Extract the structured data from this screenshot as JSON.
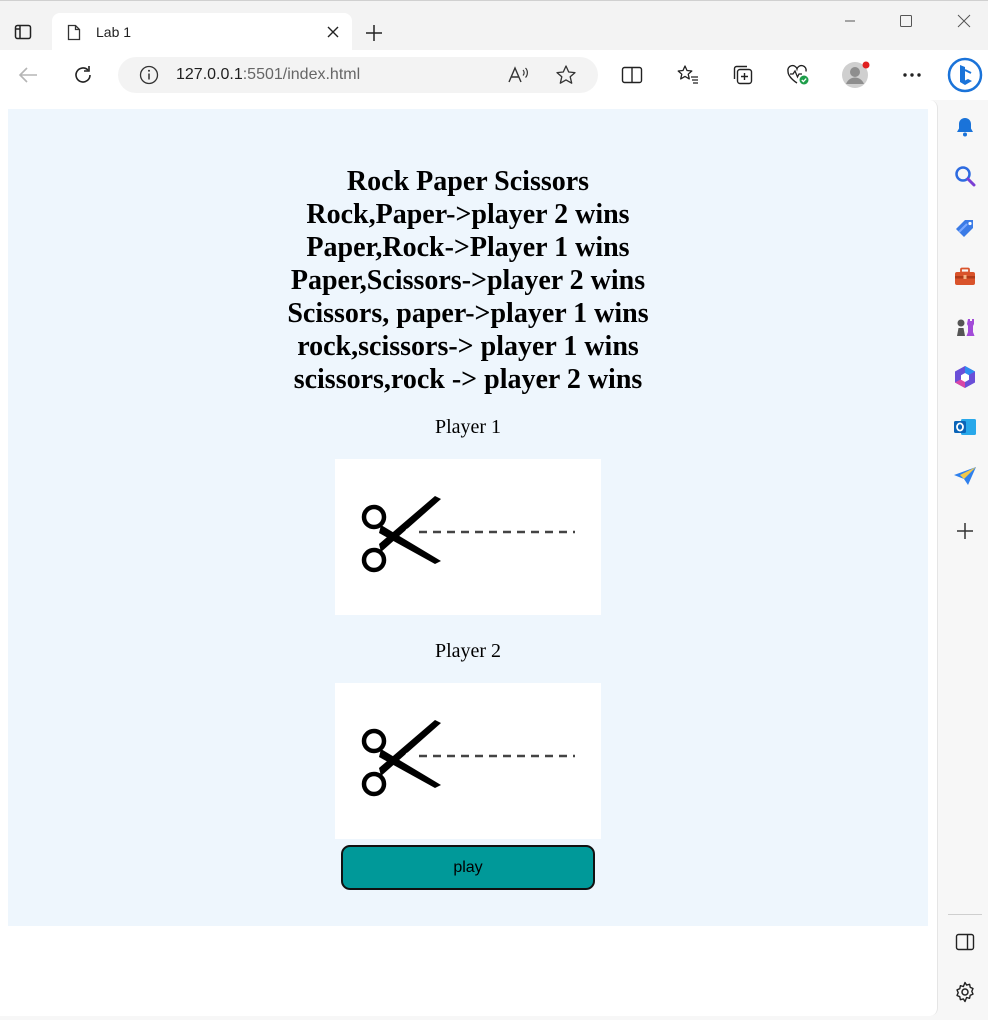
{
  "browser": {
    "tab_title": "Lab 1",
    "url_host": "127.0.0.1",
    "url_rest": ":5501/index.html"
  },
  "page": {
    "heading_lines": [
      "Rock Paper Scissors",
      "Rock,Paper->player 2 wins",
      "Paper,Rock->Player 1 wins",
      "Paper,Scissors->player 2 wins",
      "Scissors, paper->player 1 wins",
      "rock,scissors-> player 1 wins",
      "scissors,rock -> player 2 wins"
    ],
    "player1_label": "Player 1",
    "player2_label": "Player 2",
    "player1_choice": "scissors",
    "player2_choice": "scissors",
    "play_button": "play"
  },
  "colors": {
    "page_background": "#eef6fd",
    "button_color": "#009999"
  }
}
